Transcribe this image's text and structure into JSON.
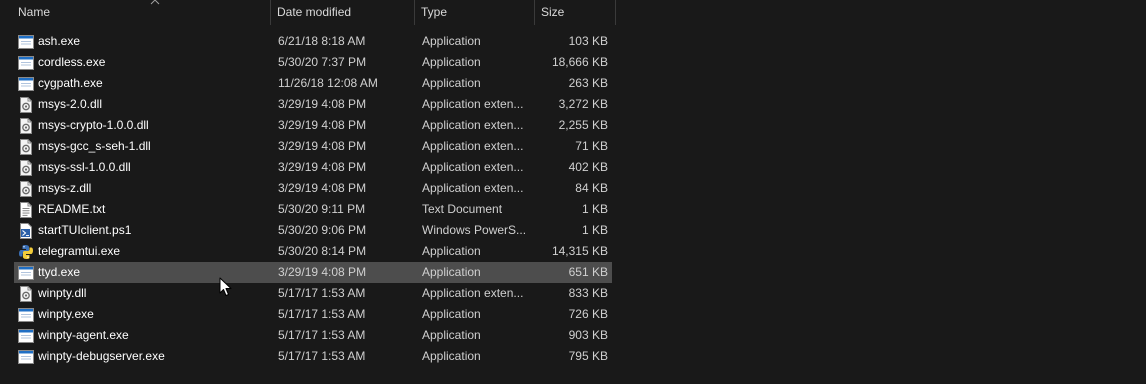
{
  "columns": {
    "name": "Name",
    "date": "Date modified",
    "type": "Type",
    "size": "Size"
  },
  "sort": {
    "column": "name",
    "icon": "chevron-up-icon"
  },
  "files": [
    {
      "name": "ash.exe",
      "date": "6/21/18 8:18 AM",
      "type": "Application",
      "size": "103 KB",
      "icon": "app-window-icon"
    },
    {
      "name": "cordless.exe",
      "date": "5/30/20 7:37 PM",
      "type": "Application",
      "size": "18,666 KB",
      "icon": "app-window-icon"
    },
    {
      "name": "cygpath.exe",
      "date": "11/26/18 12:08 AM",
      "type": "Application",
      "size": "263 KB",
      "icon": "app-window-icon"
    },
    {
      "name": "msys-2.0.dll",
      "date": "3/29/19 4:08 PM",
      "type": "Application exten...",
      "size": "3,272 KB",
      "icon": "dll-gear-file-icon"
    },
    {
      "name": "msys-crypto-1.0.0.dll",
      "date": "3/29/19 4:08 PM",
      "type": "Application exten...",
      "size": "2,255 KB",
      "icon": "dll-gear-file-icon"
    },
    {
      "name": "msys-gcc_s-seh-1.dll",
      "date": "3/29/19 4:08 PM",
      "type": "Application exten...",
      "size": "71 KB",
      "icon": "dll-gear-file-icon"
    },
    {
      "name": "msys-ssl-1.0.0.dll",
      "date": "3/29/19 4:08 PM",
      "type": "Application exten...",
      "size": "402 KB",
      "icon": "dll-gear-file-icon"
    },
    {
      "name": "msys-z.dll",
      "date": "3/29/19 4:08 PM",
      "type": "Application exten...",
      "size": "84 KB",
      "icon": "dll-gear-file-icon"
    },
    {
      "name": "README.txt",
      "date": "5/30/20 9:11 PM",
      "type": "Text Document",
      "size": "1 KB",
      "icon": "text-file-icon"
    },
    {
      "name": "startTUIclient.ps1",
      "date": "5/30/20 9:06 PM",
      "type": "Windows PowerS...",
      "size": "1 KB",
      "icon": "powershell-file-icon"
    },
    {
      "name": "telegramtui.exe",
      "date": "5/30/20 8:14 PM",
      "type": "Application",
      "size": "14,315 KB",
      "icon": "python-app-icon"
    },
    {
      "name": "ttyd.exe",
      "date": "3/29/19 4:08 PM",
      "type": "Application",
      "size": "651 KB",
      "icon": "app-window-icon",
      "hovered": true
    },
    {
      "name": "winpty.dll",
      "date": "5/17/17 1:53 AM",
      "type": "Application exten...",
      "size": "833 KB",
      "icon": "dll-gear-file-icon"
    },
    {
      "name": "winpty.exe",
      "date": "5/17/17 1:53 AM",
      "type": "Application",
      "size": "726 KB",
      "icon": "app-window-icon"
    },
    {
      "name": "winpty-agent.exe",
      "date": "5/17/17 1:53 AM",
      "type": "Application",
      "size": "903 KB",
      "icon": "app-window-icon"
    },
    {
      "name": "winpty-debugserver.exe",
      "date": "5/17/17 1:53 AM",
      "type": "Application",
      "size": "795 KB",
      "icon": "app-window-icon"
    }
  ],
  "pointer": {
    "icon": "mouse-pointer-icon"
  }
}
